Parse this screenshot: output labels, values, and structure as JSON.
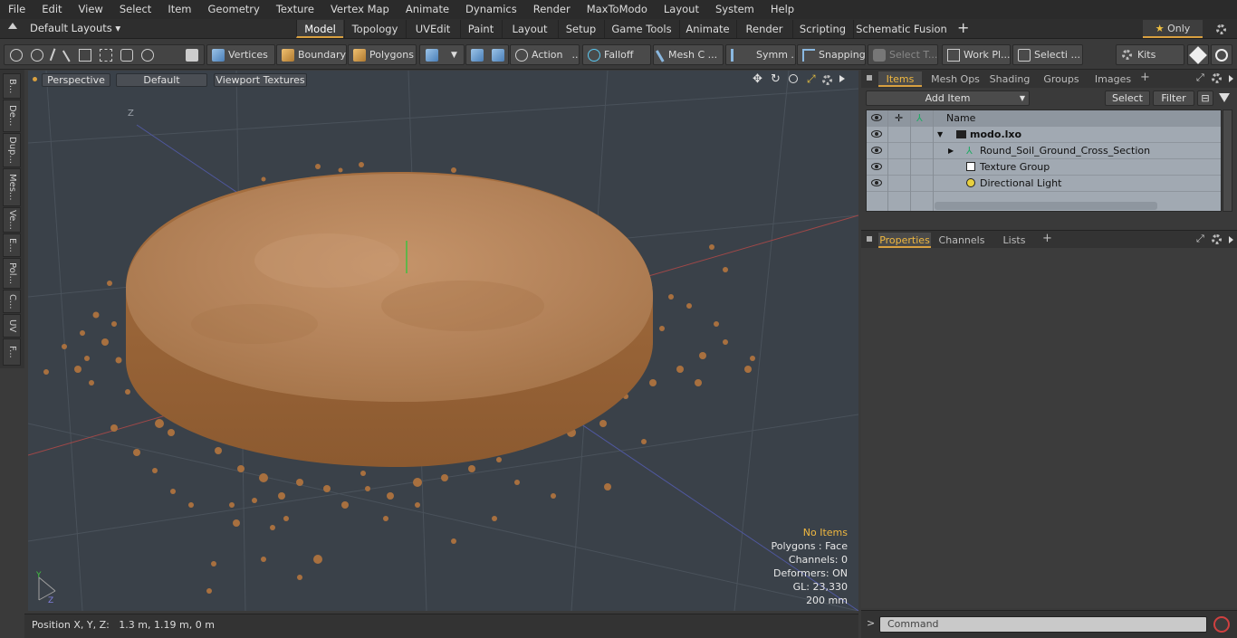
{
  "menu": [
    "File",
    "Edit",
    "View",
    "Select",
    "Item",
    "Geometry",
    "Texture",
    "Vertex Map",
    "Animate",
    "Dynamics",
    "Render",
    "MaxToModo",
    "Layout",
    "System",
    "Help"
  ],
  "layout_selector": "Default Layouts",
  "layout_tabs": [
    "Model",
    "Topology",
    "UVEdit",
    "Paint",
    "Layout",
    "Setup",
    "Game Tools",
    "Animate",
    "Render",
    "Scripting",
    "Schematic Fusion"
  ],
  "active_layout_tab": "Model",
  "only_label": "Only",
  "toolbar": {
    "vertices": "Vertices",
    "boundary": "Boundary",
    "polygons": "Polygons",
    "action": "Action",
    "falloff": "Falloff",
    "mesh": "Mesh C ...",
    "symm": "Symm ...",
    "snapping": "Snapping",
    "select_t": "Select T...",
    "work_pl": "Work Pl...",
    "selecti": "Selecti ...",
    "kits": "Kits"
  },
  "left_tabs": [
    "B...",
    "De...",
    "Dup...",
    "Mes...",
    "Ve...",
    "E...",
    "Pol...",
    "C...",
    "UV",
    "F..."
  ],
  "viewport": {
    "view_mode": "Perspective",
    "shading": "Default",
    "textures": "Viewport Textures",
    "axis_label": "Z",
    "stats": {
      "items": "No Items",
      "polygons": "Polygons : Face",
      "channels": "Channels: 0",
      "deformers": "Deformers: ON",
      "gl": "GL: 23,330",
      "scale": "200 mm"
    }
  },
  "status": "Position X, Y, Z:   1.3 m, 1.19 m, 0 m",
  "items_panel": {
    "tabs": [
      "Items",
      "Mesh Ops",
      "Shading",
      "Groups",
      "Images"
    ],
    "active_tab": "Items",
    "add_item": "Add Item",
    "select": "Select",
    "filter": "Filter",
    "column_name": "Name",
    "tree": [
      {
        "label": "modo.lxo",
        "level": 0,
        "bold": true
      },
      {
        "label": "Round_Soil_Ground_Cross_Section",
        "level": 1,
        "bold": false
      },
      {
        "label": "Texture Group",
        "level": 1,
        "bold": false
      },
      {
        "label": "Directional Light",
        "level": 1,
        "bold": false
      }
    ]
  },
  "properties_panel": {
    "tabs": [
      "Properties",
      "Channels",
      "Lists"
    ],
    "active_tab": "Properties"
  },
  "command_placeholder": "Command",
  "colors": {
    "accent": "#d8a040",
    "soil": "#b98652",
    "viewport_bg": "#3a4149"
  }
}
